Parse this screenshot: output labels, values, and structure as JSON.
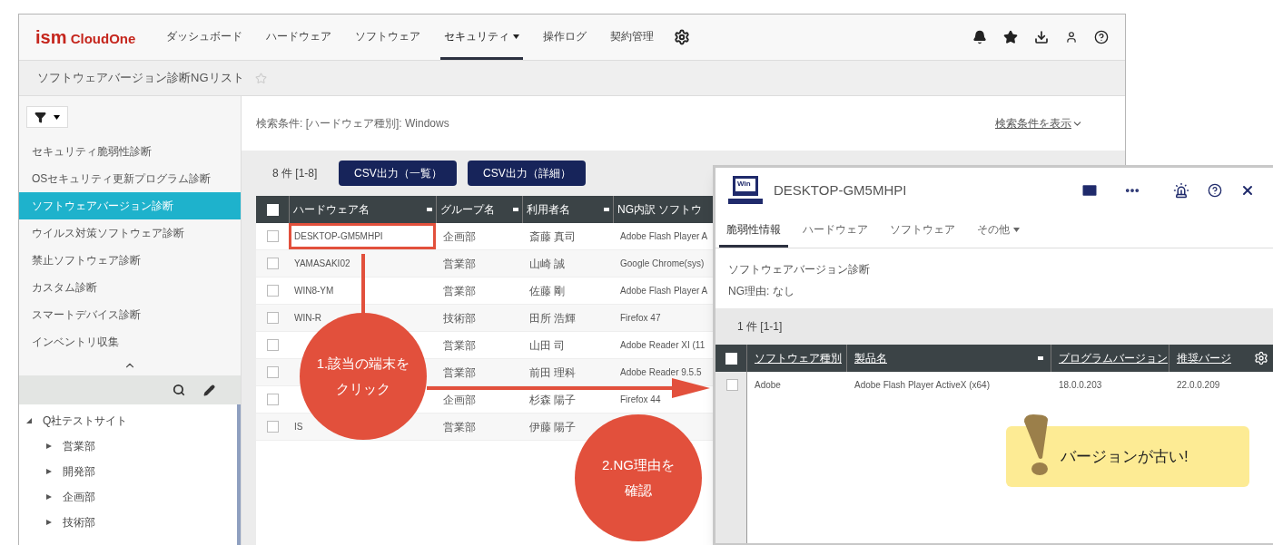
{
  "main_window": {
    "logo": {
      "prefix": "ism",
      "name": "CloudOne"
    },
    "nav": [
      {
        "label": "ダッシュボード",
        "selected": false,
        "dropdown": false
      },
      {
        "label": "ハードウェア",
        "selected": false,
        "dropdown": false
      },
      {
        "label": "ソフトウェア",
        "selected": false,
        "dropdown": false
      },
      {
        "label": "セキュリティ",
        "selected": true,
        "dropdown": true
      },
      {
        "label": "操作ログ",
        "selected": false,
        "dropdown": false
      },
      {
        "label": "契約管理",
        "selected": false,
        "dropdown": false
      }
    ],
    "page_title": "ソフトウェアバージョン診断NGリスト",
    "sidebar": {
      "items": [
        {
          "label": "セキュリティ脆弱性診断",
          "selected": false
        },
        {
          "label": "OSセキュリティ更新プログラム診断",
          "selected": false
        },
        {
          "label": "ソフトウェアバージョン診断",
          "selected": true
        },
        {
          "label": "ウイルス対策ソフトウェア診断",
          "selected": false
        },
        {
          "label": "禁止ソフトウェア診断",
          "selected": false
        },
        {
          "label": "カスタム診断",
          "selected": false
        },
        {
          "label": "スマートデバイス診断",
          "selected": false
        },
        {
          "label": "インベントリ収集",
          "selected": false
        }
      ],
      "tree": [
        {
          "label": "Q社テストサイト",
          "expanded": true,
          "children": [
            {
              "label": "営業部",
              "expanded": false
            },
            {
              "label": "開発部",
              "expanded": false
            },
            {
              "label": "企画部",
              "expanded": false
            },
            {
              "label": "技術部",
              "expanded": false
            }
          ]
        }
      ]
    },
    "search_condition": "検索条件: [ハードウェア種別]: Windows",
    "show_condition_link": "検索条件を表示",
    "count": "8 件 [1-8]",
    "buttons": [
      "CSV出力（一覧）",
      "CSV出力（詳細）"
    ],
    "table": {
      "all_checked": false,
      "columns": [
        "ハードウェア名",
        "グループ名",
        "利用者名",
        "NG内訳 ソフトウ"
      ],
      "rows": [
        {
          "checked": false,
          "highlighted": true,
          "cells": [
            "DESKTOP-GM5MHPI",
            "企画部",
            "斎藤 真司",
            "Adobe Flash Player A"
          ]
        },
        {
          "checked": false,
          "highlighted": false,
          "cells": [
            "YAMASAKI02",
            "営業部",
            "山崎 誠",
            "Google Chrome(sys)"
          ]
        },
        {
          "checked": false,
          "highlighted": false,
          "cells": [
            "WIN8-YM",
            "営業部",
            "佐藤 剛",
            "Adobe Flash Player A"
          ]
        },
        {
          "checked": false,
          "highlighted": false,
          "cells": [
            "WIN-R",
            "技術部",
            "田所 浩輝",
            "Firefox 47"
          ]
        },
        {
          "checked": false,
          "highlighted": false,
          "cells": [
            null,
            "営業部",
            "山田 司",
            "Adobe Reader XI (11"
          ]
        },
        {
          "checked": false,
          "highlighted": false,
          "cells": [
            null,
            "営業部",
            "前田 理科",
            "Adobe Reader 9.5.5"
          ]
        },
        {
          "checked": false,
          "highlighted": false,
          "cells": [
            null,
            "企画部",
            "杉森 陽子",
            "Firefox 44"
          ]
        },
        {
          "checked": false,
          "highlighted": false,
          "cells": [
            "IS",
            "営業部",
            "伊藤 陽子",
            null
          ]
        }
      ]
    }
  },
  "detail_window": {
    "icon_label": "Win",
    "title": "DESKTOP-GM5MHPI",
    "tabs": [
      {
        "label": "脆弱性情報",
        "selected": true,
        "dropdown": false
      },
      {
        "label": "ハードウェア",
        "selected": false,
        "dropdown": false
      },
      {
        "label": "ソフトウェア",
        "selected": false,
        "dropdown": false
      },
      {
        "label": "その他",
        "selected": false,
        "dropdown": true
      }
    ],
    "section_title": "ソフトウェアバージョン診断",
    "ng_reason": "NG理由: なし",
    "count": "1 件 [1-1]",
    "table": {
      "all_checked": false,
      "columns": [
        "ソフトウェア種別",
        "製品名",
        "プログラムバージョン",
        "推奨バージ"
      ],
      "rows": [
        {
          "checked": false,
          "cells": [
            "Adobe",
            "Adobe Flash Player ActiveX (x64)",
            "18.0.0.203",
            "22.0.0.209"
          ]
        }
      ]
    }
  },
  "annotations": [
    {
      "kind": "step",
      "lines": [
        "1.該当の端末を",
        "クリック"
      ]
    },
    {
      "kind": "step",
      "lines": [
        "2.NG理由を",
        "確認"
      ]
    },
    {
      "kind": "callout",
      "lines": [
        "バージョンが古い!"
      ]
    }
  ]
}
